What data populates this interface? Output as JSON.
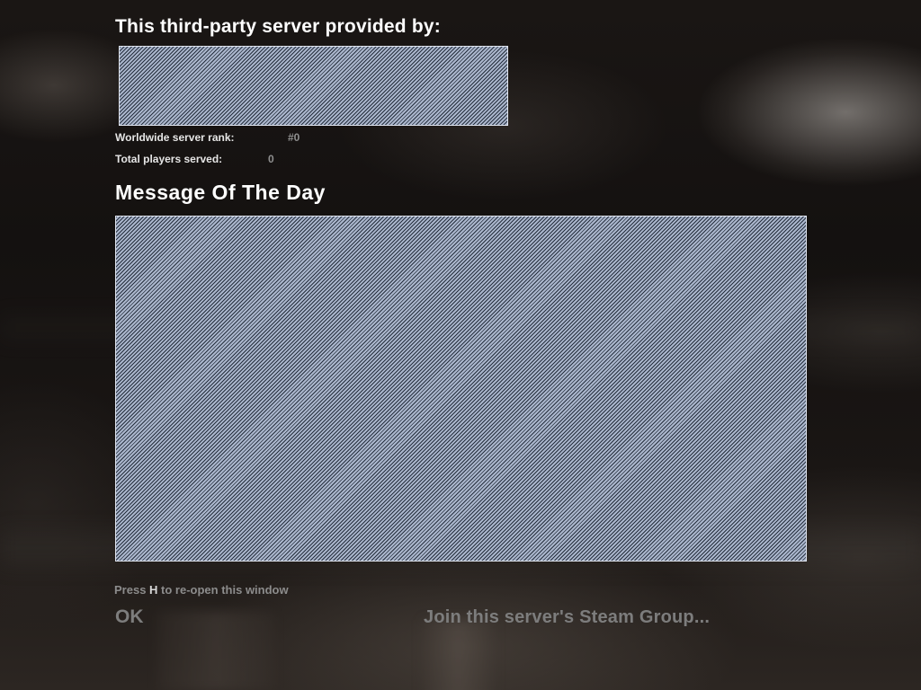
{
  "provider": {
    "title": "This third-party server provided by:"
  },
  "stats": {
    "rank_label": "Worldwide server rank:",
    "rank_value": "#0",
    "players_label": "Total players served:",
    "players_value": "0"
  },
  "motd": {
    "title": "Message Of The Day"
  },
  "footer": {
    "hint_prefix": "Press ",
    "hint_key": "H",
    "hint_suffix": " to re-open this window",
    "ok_label": "OK",
    "steam_label": "Join this server's Steam Group..."
  }
}
